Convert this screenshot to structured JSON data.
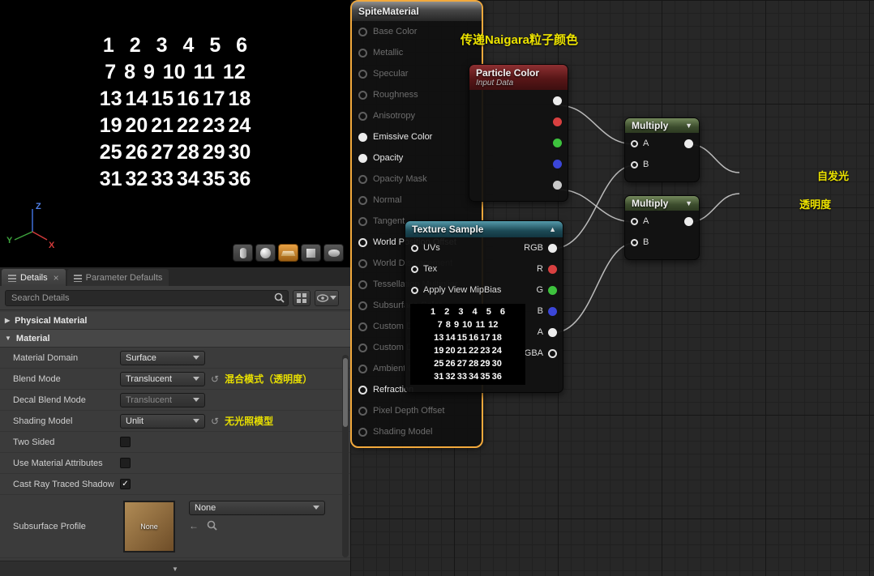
{
  "icons": {
    "close": "×",
    "caret_down": "▼",
    "caret_up": "▲",
    "section_collapsed": "▶",
    "section_expanded": "▼",
    "reset": "↺",
    "back_arrow": "←",
    "check": "✓",
    "expander": "▼"
  },
  "viewport": {
    "rows": [
      "1 2 3 4 5 6",
      "7 8 9 10 11 12",
      "13 14 15 16 17 18",
      "19 20 21 22 23 24",
      "25 26 27 28 29 30",
      "31 32 33 34 35 36"
    ],
    "axis": {
      "x": "X",
      "y": "Y",
      "z": "Z"
    }
  },
  "tabs": {
    "details": "Details",
    "parameter_defaults": "Parameter Defaults"
  },
  "search": {
    "placeholder": "Search Details"
  },
  "details": {
    "sections": {
      "physical_material": "Physical Material",
      "material": "Material"
    },
    "material_domain": {
      "label": "Material Domain",
      "value": "Surface"
    },
    "blend_mode": {
      "label": "Blend Mode",
      "value": "Translucent",
      "annotation": "混合模式（透明度）"
    },
    "decal_blend_mode": {
      "label": "Decal Blend Mode",
      "value": "Translucent"
    },
    "shading_model": {
      "label": "Shading Model",
      "value": "Unlit",
      "annotation": "无光照模型"
    },
    "two_sided": {
      "label": "Two Sided"
    },
    "use_material_attributes": {
      "label": "Use Material Attributes"
    },
    "cast_ray_traced_shadow": {
      "label": "Cast Ray Traced Shadow"
    },
    "subsurface_profile": {
      "label": "Subsurface Profile",
      "value": "None",
      "thumb": "None"
    }
  },
  "graph": {
    "comment": "传递Naigara粒子颜色",
    "particle_color": {
      "title": "Particle Color",
      "subtitle": "Input Data"
    },
    "texture_sample": {
      "title": "Texture Sample",
      "inputs": [
        "UVs",
        "Tex",
        "Apply View MipBias"
      ],
      "outputs": [
        "RGB",
        "R",
        "G",
        "B",
        "A",
        "RGBA"
      ]
    },
    "multiply1": {
      "title": "Multiply",
      "a": "A",
      "b": "B"
    },
    "multiply2": {
      "title": "Multiply",
      "a": "A",
      "b": "B"
    },
    "material": {
      "title": "SpiteMaterial",
      "pins": [
        "Base Color",
        "Metallic",
        "Specular",
        "Roughness",
        "Anisotropy",
        "Emissive Color",
        "Opacity",
        "Opacity Mask",
        "Normal",
        "Tangent",
        "World Position Offset",
        "World Displacement",
        "Tessellation Multiplier",
        "Subsurface Color",
        "Custom Data 0",
        "Custom Data 1",
        "Ambient Occlusion",
        "Refraction",
        "Pixel Depth Offset",
        "Shading Model"
      ],
      "annotations": {
        "emissive": "自发光",
        "opacity": "透明度"
      }
    }
  }
}
